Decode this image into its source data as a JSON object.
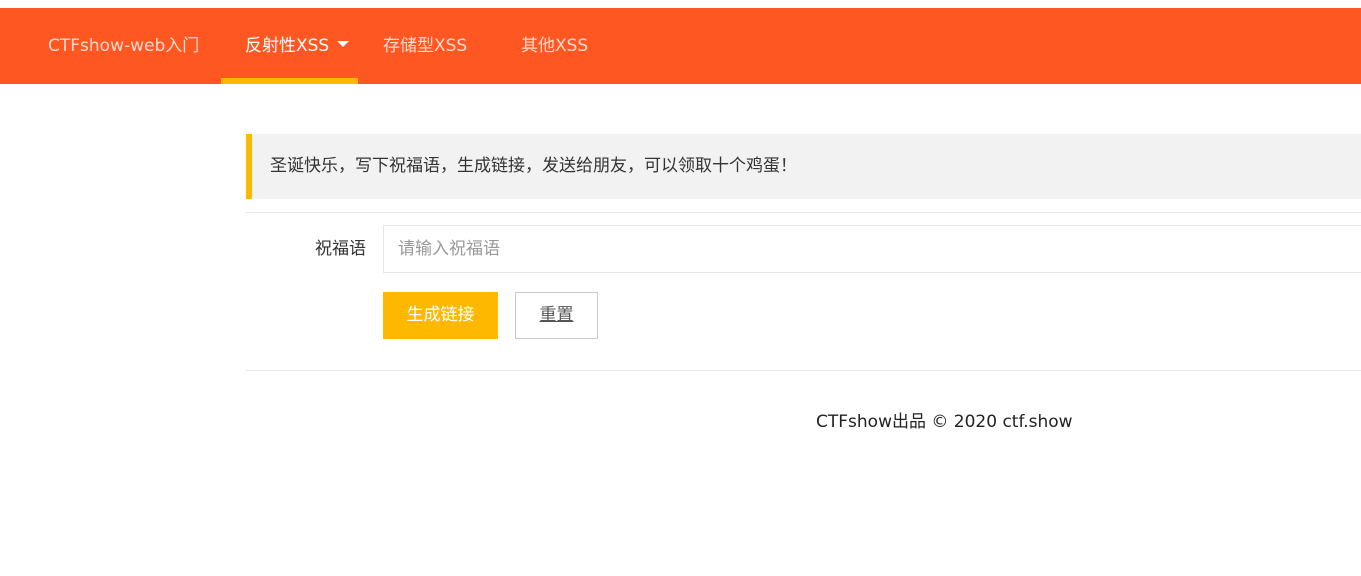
{
  "nav": {
    "items": [
      {
        "label": "CTFshow-web入门"
      },
      {
        "label": "反射性XSS"
      },
      {
        "label": "存储型XSS"
      },
      {
        "label": "其他XSS"
      }
    ]
  },
  "notice": {
    "text": "圣诞快乐，写下祝福语，生成链接，发送给朋友，可以领取十个鸡蛋！"
  },
  "form": {
    "label": "祝福语",
    "placeholder": "请输入祝福语",
    "value": "",
    "submit_label": "生成链接",
    "reset_label": "重置"
  },
  "footer": {
    "text": "CTFshow出品 © 2020 ctf.show"
  },
  "colors": {
    "navbar": "#ff5722",
    "accent": "#ffb800",
    "notice_bg": "#f2f2f2"
  },
  "icons": {
    "nav_dropdown": "caret-down-icon"
  }
}
